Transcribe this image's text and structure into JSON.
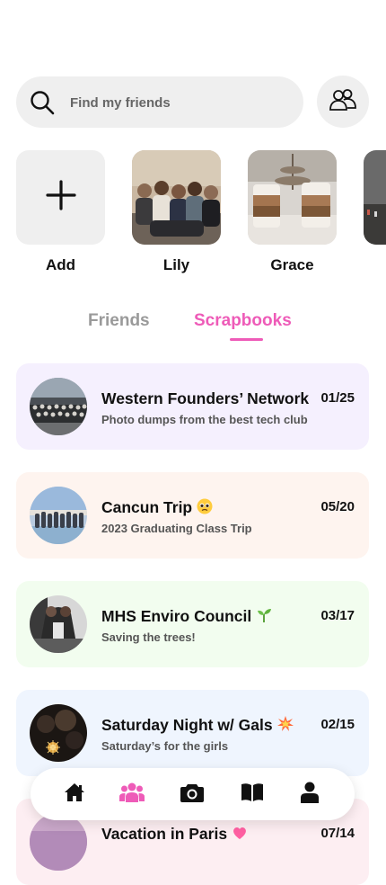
{
  "search": {
    "placeholder": "Find my friends"
  },
  "stories": [
    {
      "name": "Add"
    },
    {
      "name": "Lily"
    },
    {
      "name": "Grace"
    }
  ],
  "tabs": [
    {
      "label": "Friends",
      "active": false
    },
    {
      "label": "Scrapbooks",
      "active": true
    }
  ],
  "colors": {
    "accent": "#ee5bb8",
    "card_purple": "#f5f0fe",
    "card_peach": "#fef4ef",
    "card_green": "#f2fdef",
    "card_blue": "#eff5fe",
    "card_pink": "#fdeef2"
  },
  "scrapbooks": [
    {
      "title": "Western Founders’ Network",
      "subtitle": "Photo dumps from the best tech club",
      "date": "01/25",
      "emoji": ""
    },
    {
      "title": "Cancun Trip",
      "subtitle": "2023 Graduating Class Trip",
      "date": "05/20",
      "emoji": "pleading-face"
    },
    {
      "title": "MHS Enviro Council",
      "subtitle": "Saving the trees!",
      "date": "03/17",
      "emoji": "seedling"
    },
    {
      "title": "Saturday Night w/ Gals",
      "subtitle": "Saturday’s for the girls",
      "date": "02/15",
      "emoji": "sparkle-burst"
    },
    {
      "title": "Vacation in Paris",
      "subtitle": "",
      "date": "07/14",
      "emoji": "sparkling-heart"
    }
  ],
  "nav": [
    {
      "icon": "home-icon",
      "active": false
    },
    {
      "icon": "friends-icon",
      "active": true
    },
    {
      "icon": "camera-icon",
      "active": false
    },
    {
      "icon": "book-icon",
      "active": false
    },
    {
      "icon": "profile-icon",
      "active": false
    }
  ]
}
